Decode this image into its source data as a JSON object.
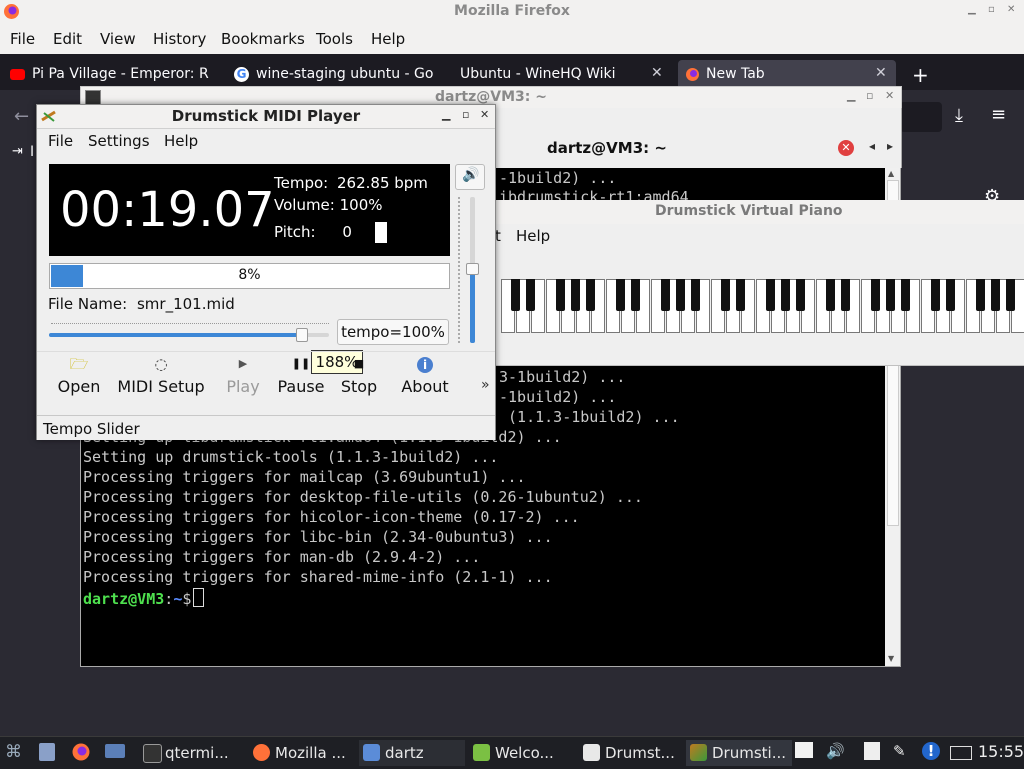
{
  "firefox": {
    "title": "Mozilla Firefox",
    "menu": [
      "File",
      "Edit",
      "View",
      "History",
      "Bookmarks",
      "Tools",
      "Help"
    ],
    "tabs": [
      {
        "label": "Pi Pa Village - Emperor: R"
      },
      {
        "label": "wine-staging ubuntu - Go"
      },
      {
        "label": "Ubuntu - WineHQ Wiki"
      },
      {
        "label": "New Tab"
      }
    ],
    "new_tab_glyph": "+",
    "bookmark_fragment": "I"
  },
  "terminal": {
    "title": "dartz@VM3: ~",
    "tab_title": "dartz@VM3: ~",
    "partial_lines": [
      "-1build2) ...",
      "ibdrumstick-rt1:amd64"
    ],
    "lines": [
      "3-1build2) ...",
      "-1build2) ...",
      " (1.1.3-1build2) ...",
      "Setting up libdrumstick-rt1:amd64 (1.1.3-1build2) ...",
      "Setting up drumstick-tools (1.1.3-1build2) ...",
      "Processing triggers for mailcap (3.69ubuntu1) ...",
      "Processing triggers for desktop-file-utils (0.26-1ubuntu2) ...",
      "Processing triggers for hicolor-icon-theme (0.17-2) ...",
      "Processing triggers for libc-bin (2.34-0ubuntu3) ...",
      "Processing triggers for man-db (2.9.4-2) ...",
      "Processing triggers for shared-mime-info (2.1-1) ..."
    ],
    "prompt_user": "dartz@VM3",
    "prompt_sep": ":",
    "prompt_path": "~",
    "prompt_symbol": "$"
  },
  "piano": {
    "title": "Drumstick Virtual Piano",
    "menu": [
      "t",
      "Help"
    ]
  },
  "player": {
    "title": "Drumstick MIDI Player",
    "menu": [
      "File",
      "Settings",
      "Help"
    ],
    "time": "00:19.07",
    "tempo_label": "Tempo:",
    "tempo_value": "262.85 bpm",
    "volume_label": "Volume:",
    "volume_value": "100%",
    "pitch_label": "Pitch:",
    "pitch_value": "0",
    "progress": 0.08,
    "progress_text": "8%",
    "file_label": "File Name:",
    "file_name": "smr_101.mid",
    "tempo_slider": 0.9,
    "tempo_button": "tempo=100%",
    "tooltip": "188%",
    "volume_level": 0.5,
    "buttons": [
      {
        "label": "Open",
        "icon": "folder-open-icon"
      },
      {
        "label": "MIDI Setup",
        "icon": "midi-setup-icon"
      },
      {
        "label": "Play",
        "icon": "play-icon",
        "disabled": true
      },
      {
        "label": "Pause",
        "icon": "pause-icon"
      },
      {
        "label": "Stop",
        "icon": "stop-icon"
      },
      {
        "label": "About",
        "icon": "info-icon"
      }
    ],
    "extension_glyph": "»",
    "status": "Tempo Slider"
  },
  "taskbar": {
    "items": [
      {
        "label": "qtermi..."
      },
      {
        "label": "Mozilla ..."
      },
      {
        "label": "dartz"
      },
      {
        "label": "Welco..."
      },
      {
        "label": "Drumst..."
      },
      {
        "label": "Drumsti..."
      }
    ],
    "clock": "15:55"
  },
  "colors": {
    "prompt_user": "#4ee04e",
    "prompt_path": "#5b8cff",
    "progress_fill": "#3d87d6"
  }
}
